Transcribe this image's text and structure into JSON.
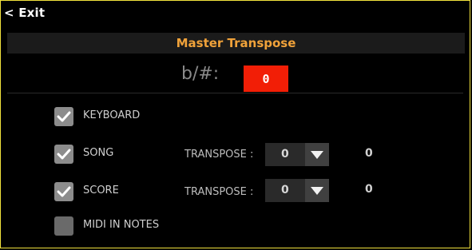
{
  "header": {
    "exit_label": "< Exit"
  },
  "panel": {
    "title": "Master Transpose",
    "transpose_label": "b/#:",
    "transpose_value": "0"
  },
  "options": {
    "keyboard": {
      "label": "KEYBOARD",
      "checked": true
    },
    "song": {
      "label": "SONG",
      "checked": true,
      "transpose_label": "TRANSPOSE :",
      "transpose_value": "0",
      "result": "0"
    },
    "score": {
      "label": "SCORE",
      "checked": true,
      "transpose_label": "TRANSPOSE :",
      "transpose_value": "0",
      "result": "0"
    },
    "midi_in_notes": {
      "label": "MIDI IN NOTES",
      "checked": false
    }
  },
  "colors": {
    "frame_border": "#f2e23c",
    "title": "#f0a23a",
    "transpose_value_bg": "#f21e06"
  },
  "icons": {
    "checkbox": "check-icon",
    "dropdown": "triangle-down-icon"
  }
}
